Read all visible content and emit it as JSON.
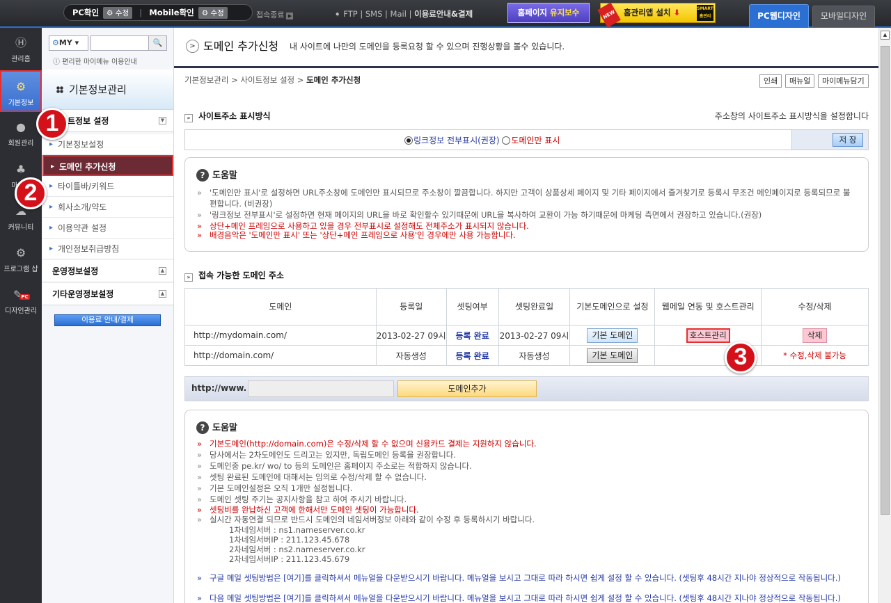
{
  "topbar": {
    "pc_confirm": "PC확인",
    "edit1": "수정",
    "mobile_confirm": "Mobile확인",
    "edit2": "수정",
    "logout": "접속종료",
    "links": "FTP | SMS | Mail",
    "links_b": "이용료안내&결제",
    "maint_pre": "홈페이지",
    "maint_hl": "유지보수",
    "app_new": "NEW",
    "app": "홈관리앱 설치",
    "smart": "SMART 홈관리",
    "tab_pc": "PC웹디자인",
    "tab_mobile": "모바일디자인"
  },
  "leftnav": [
    {
      "label": "관리홈",
      "icon": "home-icon"
    },
    {
      "label": "기본정보",
      "icon": "gear-icon"
    },
    {
      "label": "회원관리",
      "icon": "user-icon"
    },
    {
      "label": "마케팅",
      "icon": "sprout-icon"
    },
    {
      "label": "커뮤니티",
      "icon": "chat-icon"
    },
    {
      "label": "프로그램 샵",
      "icon": "gears-icon"
    },
    {
      "label": "디자인관리",
      "icon": "brush-icon"
    }
  ],
  "leftnav_badge": "PC",
  "submenu": {
    "my": "MY",
    "my_info": "편리한 마이메뉴 이용안내",
    "title": "기본정보관리",
    "group1": "사이트정보 설정",
    "items": [
      "기본정보설정",
      "도메인 추가신청",
      "타이틀바/키워드",
      "회사소개/약도",
      "이용약관 설정",
      "개인정보취급방침"
    ],
    "group2": "운영정보설정",
    "group3": "기타운영정보설정",
    "pay": "이용료 안내/결제"
  },
  "badges": [
    "1",
    "2",
    "3"
  ],
  "page": {
    "title": "도메인 추가신청",
    "desc": "내 사이트에 나만의 도메인을 등록요청 할 수 있으며 진행상황을 볼수 있습니다.",
    "breadcrumb": "기본정보관리 > 사이트정보 설정 > ",
    "breadcrumb_current": "도메인 추가신청",
    "print": "인쇄",
    "manual": "매뉴얼",
    "mymenu": "마이메뉴담기"
  },
  "display": {
    "title": "사이트주소 표시방식",
    "note": "주소창의 사이트주소 표시방식을 설정합니다",
    "opt1": "링크정보 전부표시(권장)",
    "opt2": "도메인만 표시",
    "save": "저 장"
  },
  "help1": {
    "title": "도움말",
    "lines": [
      {
        "t": "'도메인만 표시'로 설정하면 URL주소창에 도메인만 표시되므로 주소창이 깔끔합니다. 하지만 고객이 상품상세 페이지 및 기타 페이지에서 즐겨찾기로 등록시 무조건 메인페이지로 등록되므로 불편합니다. (비권장)",
        "c": "n"
      },
      {
        "t": "'링크정보 전부표시'로 설정하면 현재 페이지의 URL을 바로 확인할수 있기때문에 URL을 복사하여 교환이 가능 하기때문에 마케팅 측면에서 권장하고 있습니다.(권장)",
        "c": "n"
      },
      {
        "t": "상단+메인 프레임으로 사용하고 있을 경우 전부표시로 설정해도 전체주소가 표시되지 않습니다.",
        "c": "r"
      },
      {
        "t": "배경음악은 '도메인만 표시' 또는 '상단+메인 프레임으로 사용'인 경우에만 사용 가능합니다.",
        "c": "r"
      }
    ]
  },
  "domains": {
    "title": "접속 가능한 도메인 주소",
    "headers": [
      "도메인",
      "등록일",
      "셋팅여부",
      "셋팅완료일",
      "기본도메인으로 설정",
      "웹메일 연동 및 호스트관리",
      "수정/삭제"
    ],
    "rows": [
      {
        "domain": "http://mydomain.com/",
        "reg": "2013-02-27 09시",
        "status": "등록 완료",
        "done": "2013-02-27 09시",
        "btn": "기본 도메인",
        "host": "호스트관리",
        "del": "삭제"
      },
      {
        "domain": "http://domain.com/",
        "reg": "자동생성",
        "status": "등록 완료",
        "done": "자동생성",
        "btn": "기본 도메인",
        "host": "",
        "del": "* 수정,삭제 불가능"
      }
    ]
  },
  "add": {
    "prefix": "http://www.",
    "button": "도메인추가"
  },
  "help2": {
    "title": "도움말",
    "lines": [
      {
        "t": "기본도메인(http://domain.com)은 수정/삭제 할 수 없으며 신용카드 결제는 지원하지 않습니다.",
        "c": "r"
      },
      {
        "t": "당사에서는 2차도메인도 드리고는 있지만, 독립도메인 등록을 권장합니다.",
        "c": "n"
      },
      {
        "t": "도메인중 pe.kr/ wo/ to 등의 도메인은 홈페이지 주소로는 적합하지 않습니다.",
        "c": "n"
      },
      {
        "t": "셋팅 완료된 도메인에 대해서는 임의로 수정/삭제 할 수 없습니다.",
        "c": "n"
      },
      {
        "t": "기본 도메인설정은 오직 1개만 설정됩니다.",
        "c": "n"
      },
      {
        "t": "도메인 셋팅 주기는 공지사항을 참고 하여 주시기 바랍니다.",
        "c": "n"
      },
      {
        "t": "셋팅비를 완납하신 고객에 한해서만 도메인 셋팅이 가능합니다.",
        "c": "r"
      },
      {
        "t": "실시간 자동연결 되므로 반드시 도메인의 네임서버정보 아래와 같이 수정 후 등록하시기 바랍니다.",
        "c": "n"
      }
    ],
    "ns": [
      "1차네임서버 : ns1.nameserver.co.kr",
      "1차네임서버IP : 211.123.45.678",
      "2차네임서버 : ns2.nameserver.co.kr",
      "2차네임서버IP : 211.123.45.679"
    ],
    "blue": [
      "구글 메일 셋팅방법은 [여기]를 클릭하셔서 메뉴얼을 다운받으시기 바랍니다. 메뉴얼을 보시고 그대로 따라 하시면 쉽게 설정 할 수 있습니다. (셋팅후 48시간 지나야 정상적으로 작동됩니다.)",
      "다음 메일 셋팅방법은 [여기]를 클릭하셔서 메뉴얼을 다운받으시기 바랍니다. 메뉴얼을 보시고 그대로 따라 하시면 쉽게 설정 할 수 있습니다. (셋팅후 48시간 지나야 정상적으로 작동됩니다.)"
    ]
  }
}
